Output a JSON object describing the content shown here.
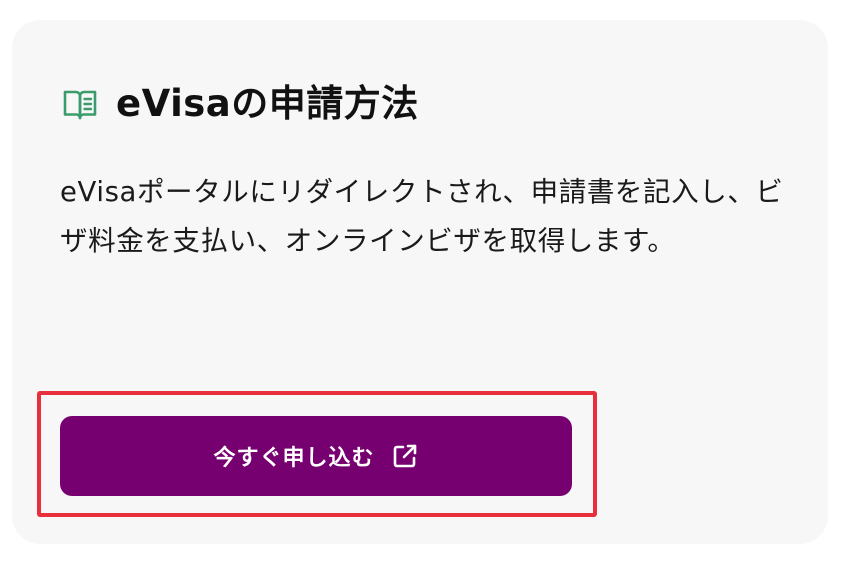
{
  "card": {
    "title": "eVisaの申請方法",
    "description": "eVisaポータルにリダイレクトされ、申請書を記入し、ビザ料金を支払い、オンラインビザを取得します。",
    "icon": "open-book-icon"
  },
  "apply_button": {
    "label": "今すぐ申し込む",
    "icon": "external-link-icon"
  },
  "colors": {
    "card_background": "#f7f7f7",
    "button_background": "#770070",
    "button_text": "#ffffff",
    "icon_green": "#3a9b6c",
    "highlight_border": "#e8303d"
  }
}
